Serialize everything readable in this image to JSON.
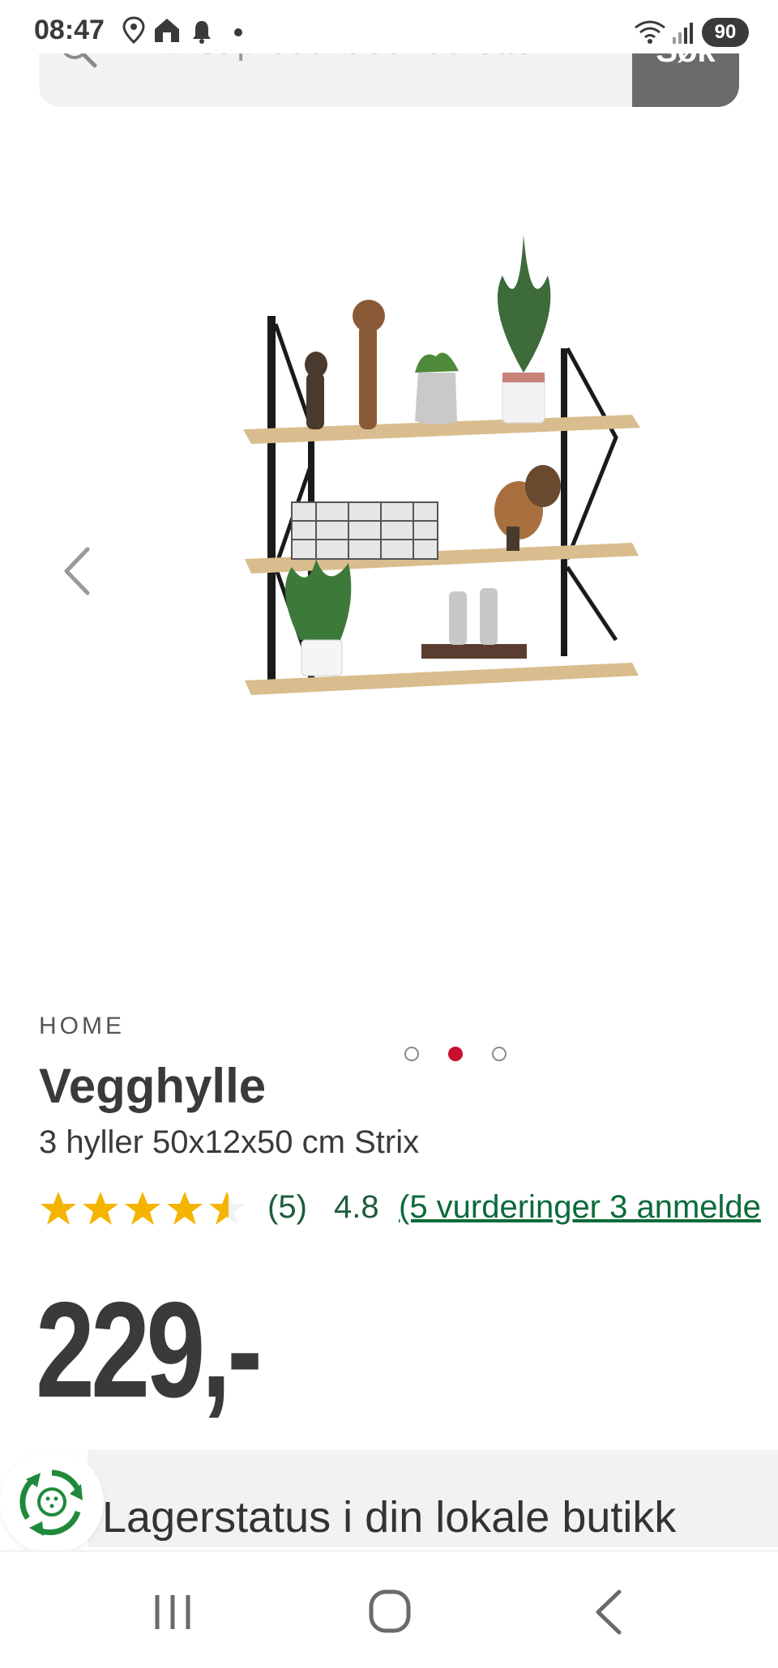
{
  "status_bar": {
    "time": "08:47",
    "battery": "90",
    "icons": [
      "location-icon",
      "home-icon",
      "notification-bell-icon",
      "dot-icon",
      "wifi-icon",
      "signal-icon"
    ]
  },
  "search": {
    "placeholder": "Hvilket produkt ser du etter?",
    "button_label": "Søk"
  },
  "gallery": {
    "image_count": 3,
    "active_index": 1,
    "prev_icon": "chevron-left-icon"
  },
  "product": {
    "brand": "HOME",
    "title": "Vegghylle",
    "subtitle": "3 hyller 50x12x50 cm Strix",
    "rating": {
      "stars": 4.8,
      "count_label": "(5)",
      "score_label": "4.8",
      "reviews_link": "(5 vurderinger 3 anmelde"
    },
    "price": "229,-"
  },
  "stock": {
    "text": "Lagerstatus i din lokale butikk"
  },
  "nav_bar": {
    "icons": [
      "recent-apps-icon",
      "home-button-icon",
      "back-icon"
    ]
  },
  "colors": {
    "accent_red": "#c8102e",
    "link_green": "#0b6b3a",
    "star_yellow": "#f5b400",
    "search_button": "#6b6b6b"
  }
}
